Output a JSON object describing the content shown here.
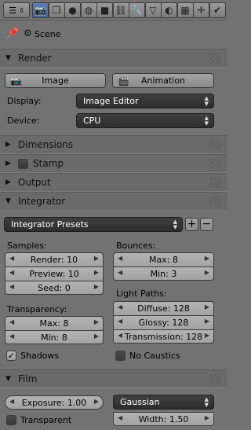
{
  "toolbar": {
    "editor_icon": "properties-editor-icon",
    "tabs": [
      {
        "name": "render-tab",
        "icon": "camera-icon",
        "glyph": "📷",
        "active": true
      },
      {
        "name": "render-layers-tab",
        "icon": "layers-icon",
        "glyph": "❐"
      },
      {
        "name": "scene-tab",
        "icon": "scene-icon",
        "glyph": "●"
      },
      {
        "name": "world-tab",
        "icon": "world-icon",
        "glyph": "◍"
      },
      {
        "name": "object-tab",
        "icon": "cube-icon",
        "glyph": "■"
      },
      {
        "name": "constraints-tab",
        "icon": "link-icon",
        "glyph": "⛓"
      },
      {
        "name": "modifiers-tab",
        "icon": "wrench-icon",
        "glyph": "🔧"
      },
      {
        "name": "data-tab",
        "icon": "mesh-data-icon",
        "glyph": "▽"
      },
      {
        "name": "material-tab",
        "icon": "material-icon",
        "glyph": "◐"
      },
      {
        "name": "texture-tab",
        "icon": "texture-icon",
        "glyph": "▦"
      },
      {
        "name": "particles-tab",
        "icon": "particles-icon",
        "glyph": "✛"
      },
      {
        "name": "physics-tab",
        "icon": "physics-icon",
        "glyph": "✔"
      }
    ]
  },
  "breadcrumb": {
    "label": "Scene"
  },
  "render": {
    "title": "Render",
    "image_button": "Image",
    "animation_button": "Animation",
    "display_label": "Display:",
    "display_value": "Image Editor",
    "device_label": "Device:",
    "device_value": "CPU"
  },
  "panels": {
    "dimensions": "Dimensions",
    "stamp": "Stamp",
    "output": "Output",
    "integrator": "Integrator",
    "film": "Film"
  },
  "integrator": {
    "presets": "Integrator Presets",
    "samples_label": "Samples:",
    "render": "Render: 10",
    "preview": "Preview: 10",
    "seed": "Seed: 0",
    "bounces_label": "Bounces:",
    "max": "Max: 8",
    "min": "Min: 3",
    "transparency_label": "Transparency:",
    "t_max": "Max: 8",
    "t_min": "Min: 8",
    "light_paths_label": "Light Paths:",
    "diffuse": "Diffuse: 128",
    "glossy": "Glossy: 128",
    "transmission": "Transmission: 128",
    "shadows": "Shadows",
    "shadows_checked": true,
    "no_caustics": "No Caustics",
    "no_caustics_checked": false
  },
  "film": {
    "exposure": "Exposure: 1.00",
    "filter": "Gaussian",
    "transparent": "Transparent",
    "transparent_checked": false,
    "width": "Width: 1.50"
  }
}
